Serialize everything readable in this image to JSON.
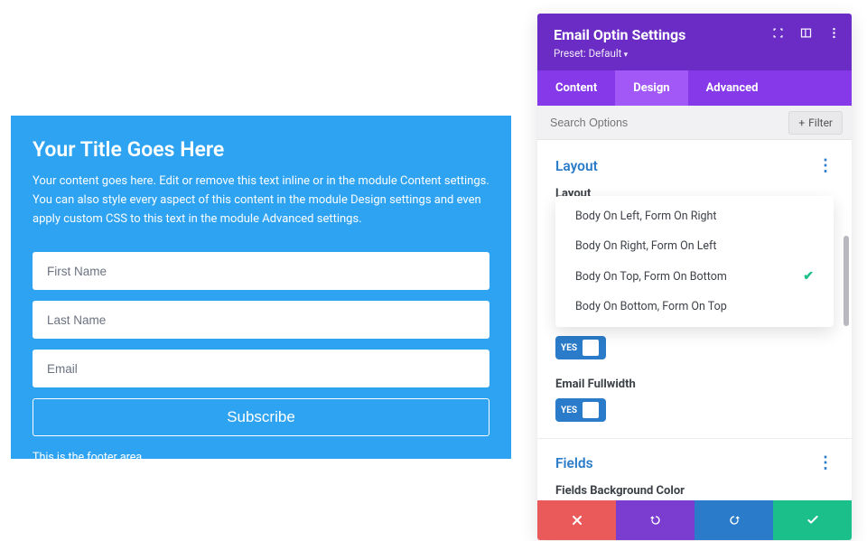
{
  "optin_preview": {
    "title": "Your Title Goes Here",
    "body": "Your content goes here. Edit or remove this text inline or in the module Content settings. You can also style every aspect of this content in the module Design settings and even apply custom CSS to this text in the module Advanced settings.",
    "first_name_placeholder": "First Name",
    "last_name_placeholder": "Last Name",
    "email_placeholder": "Email",
    "button_label": "Subscribe",
    "footer": "This is the footer area."
  },
  "panel": {
    "header": {
      "title": "Email Optin Settings",
      "preset_label": "Preset: Default"
    },
    "tabs": {
      "content": "Content",
      "design": "Design",
      "advanced": "Advanced",
      "active": "design"
    },
    "search": {
      "placeholder": "Search Options",
      "filter_label": "Filter"
    },
    "layout": {
      "section_title": "Layout",
      "control_label": "Layout",
      "options": [
        {
          "label": "Body On Left, Form On Right",
          "selected": false
        },
        {
          "label": "Body On Right, Form On Left",
          "selected": false
        },
        {
          "label": "Body On Top, Form On Bottom",
          "selected": true
        },
        {
          "label": "Body On Bottom, Form On Top",
          "selected": false
        }
      ],
      "toggle_yes": "YES",
      "email_fullwidth_label": "Email Fullwidth",
      "email_fullwidth_value": true
    },
    "fields": {
      "section_title": "Fields",
      "bg_label": "Fields Background Color",
      "swatches": [
        "#000000",
        "#ffffff",
        "#d62a2a",
        "#f27c1e",
        "#f2c91e",
        "#6bd119",
        "#1e8df2",
        "#7b3dcf"
      ]
    },
    "colors": {
      "accent_blue": "#2ea3f2",
      "link_blue": "#2a7bc9",
      "purple_dark": "#6a2cc4",
      "purple_mid": "#8639e8",
      "purple_light": "#a258f6",
      "green": "#1bbf89",
      "red": "#eb5a5a"
    }
  }
}
